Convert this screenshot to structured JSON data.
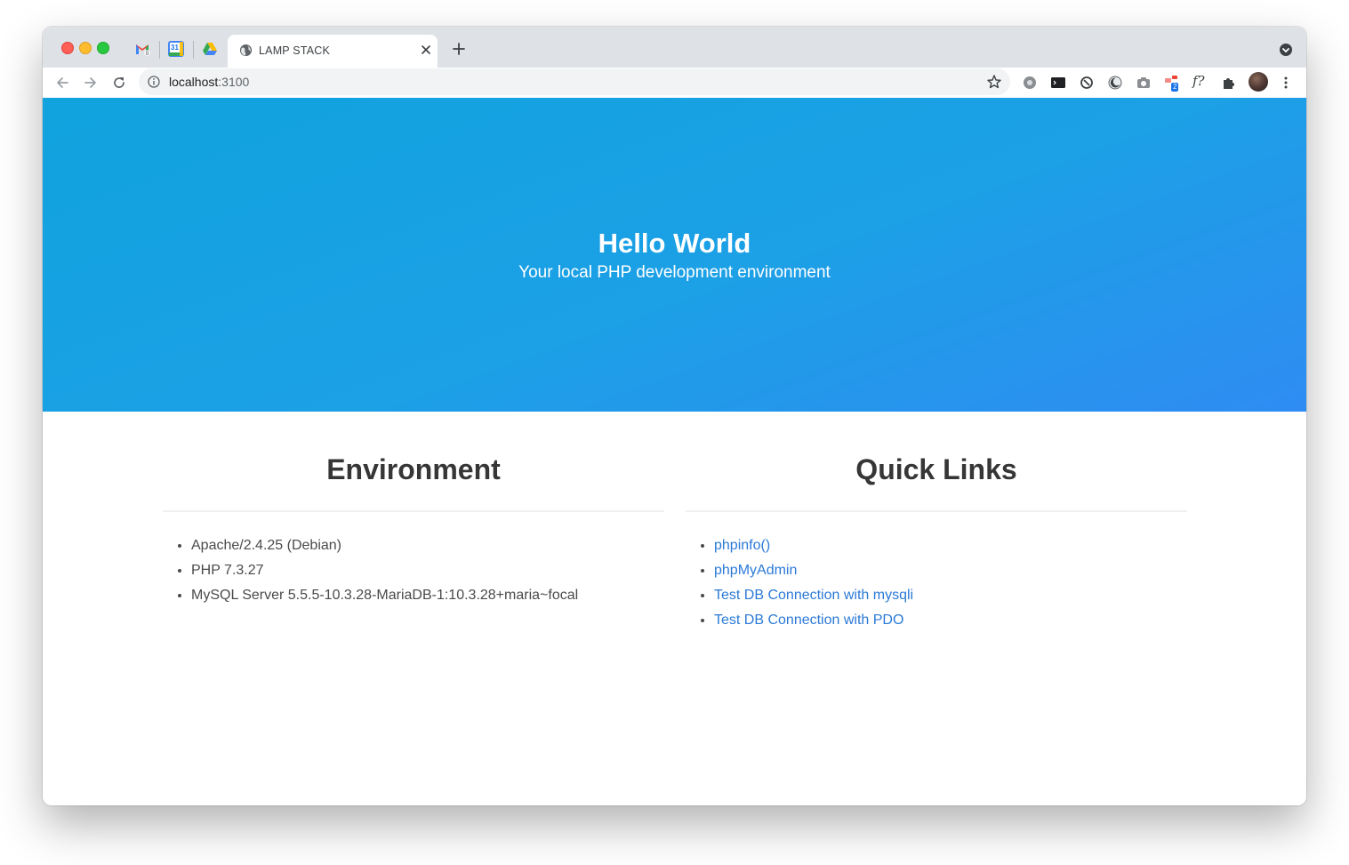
{
  "browser": {
    "tab_title": "LAMP STACK",
    "url_host": "localhost",
    "url_port": ":3100",
    "pinned_tabs": [
      "gmail-icon",
      "calendar-icon",
      "drive-icon"
    ],
    "calendar_day": "31",
    "extension_badge": "2",
    "fn_extension_label": "f?"
  },
  "hero": {
    "title": "Hello World",
    "subtitle": "Your local PHP development environment",
    "gradient_start": "#10a3de",
    "gradient_end": "#2f8cf2"
  },
  "environment": {
    "heading": "Environment",
    "items": [
      "Apache/2.4.25 (Debian)",
      "PHP 7.3.27",
      "MySQL Server 5.5.5-10.3.28-MariaDB-1:10.3.28+maria~focal"
    ]
  },
  "quick_links": {
    "heading": "Quick Links",
    "items": [
      "phpinfo()",
      "phpMyAdmin",
      "Test DB Connection with mysqli",
      "Test DB Connection with PDO"
    ],
    "link_color": "#2b7ad6"
  }
}
